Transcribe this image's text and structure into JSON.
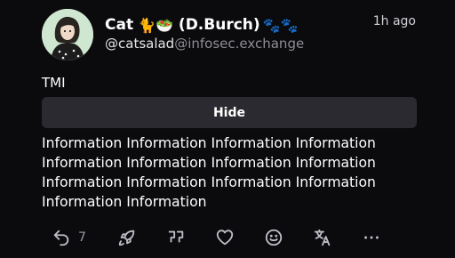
{
  "post": {
    "author": {
      "display_name": "Cat",
      "display_name_emoji": "🐈🥗",
      "display_name_suffix": "(D.Burch)",
      "display_name_badges": "🐾🐾",
      "username": "@catsalad",
      "domain": "@infosec.exchange"
    },
    "timestamp": "1h ago",
    "content_warning": "TMI",
    "hide_label": "Hide",
    "content": "Information Information Information Information Information Information Information Information Information Information Information Information Information Information"
  },
  "actions": {
    "reply_count": "7",
    "icons": [
      "reply-icon",
      "boost-icon",
      "quote-icon",
      "favourite-icon",
      "emoji-react-icon",
      "translate-icon",
      "more-icon"
    ]
  },
  "colors": {
    "background": "#0b0b0e",
    "button": "#2a2a30",
    "muted": "#8d8d95",
    "icon": "#bdbdc6"
  }
}
